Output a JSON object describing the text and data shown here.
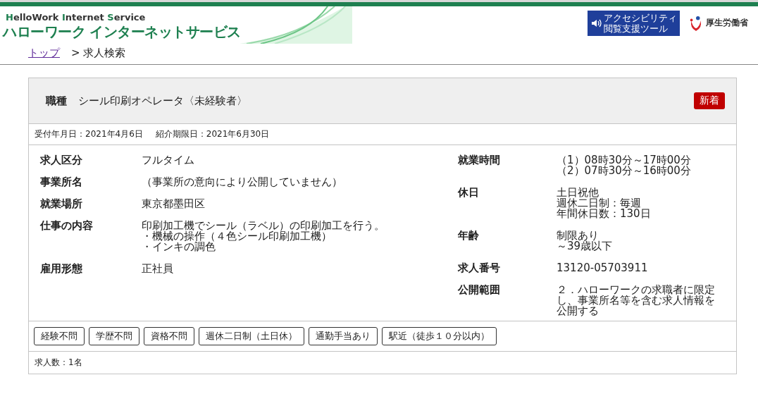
{
  "header": {
    "subtitle": "HelloWork Internet Service",
    "title": "ハローワーク インターネットサービス",
    "accessibility_badge": [
      "アクセシビリティ",
      "閲覧支援ツール"
    ],
    "ministry": "厚生労働省"
  },
  "breadcrumb": [
    {
      "label": "トップ",
      "kind": "link"
    },
    {
      "label": "> 求人検索",
      "kind": "current"
    }
  ],
  "job": {
    "occupation_label": "職種",
    "occupation": "シール印刷オペレータ〈未経験者〉",
    "new_badge": "新着",
    "dates": [
      "受付年月日：2021年4月6日",
      "紹介期限日：2021年6月30日"
    ],
    "details_left": [
      {
        "label": "求人区分",
        "lines": [
          "フルタイム"
        ]
      },
      {
        "label": "事業所名",
        "lines": [
          "（事業所の意向により公開していません）"
        ]
      },
      {
        "label": "就業場所",
        "lines": [
          "東京都墨田区"
        ]
      },
      {
        "label": "仕事の内容",
        "lines": [
          "印刷加工機でシール（ラベル）の印刷加工を行う。",
          "・機械の操作（４色シール印刷加工機）",
          "・インキの調色"
        ]
      },
      {
        "label": "雇用形態",
        "lines": [
          "正社員"
        ]
      }
    ],
    "details_right": [
      {
        "label": "就業時間",
        "lines": [
          "（1）08時30分～17時00分",
          "（2）07時30分～16時00分"
        ]
      },
      {
        "label": "休日",
        "lines": [
          "土日祝他",
          "週休二日制：毎週",
          "年間休日数：130日"
        ]
      },
      {
        "label": "年齢",
        "lines": [
          "制限あり",
          "～39歳以下"
        ]
      },
      {
        "label": "求人番号",
        "lines": [
          "13120-05703911"
        ]
      },
      {
        "label": "公開範囲",
        "lines": [
          "２．ハローワークの求職者に限定し、事業所名等を含む求人情報を公開する"
        ]
      }
    ],
    "tags": [
      "経験不問",
      "学歴不問",
      "資格不問",
      "週休二日制（土日休）",
      "通勤手当あり",
      "駅近（徒歩１０分以内）"
    ],
    "count": "求人数：1名"
  }
}
